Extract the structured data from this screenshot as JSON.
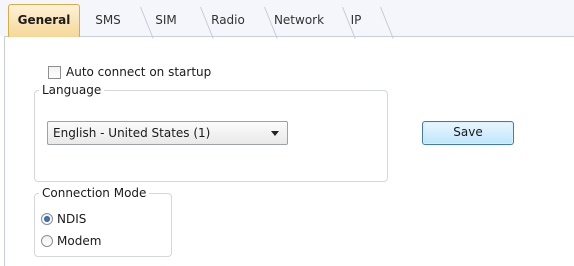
{
  "tabs": [
    {
      "label": "General",
      "active": true
    },
    {
      "label": "SMS",
      "active": false
    },
    {
      "label": "SIM",
      "active": false
    },
    {
      "label": "Radio",
      "active": false
    },
    {
      "label": "Network",
      "active": false
    },
    {
      "label": "IP",
      "active": false
    }
  ],
  "general": {
    "auto_connect": {
      "label": "Auto connect on startup",
      "checked": false
    },
    "language": {
      "group_title": "Language",
      "selected": "English - United States (1)"
    },
    "save_label": "Save",
    "connection_mode": {
      "group_title": "Connection Mode",
      "options": [
        {
          "label": "NDIS",
          "selected": true
        },
        {
          "label": "Modem",
          "selected": false
        }
      ]
    }
  },
  "colors": {
    "active_tab": "#f6d797",
    "save_button": "#bee6fd",
    "radio_dot": "#234e8f"
  }
}
